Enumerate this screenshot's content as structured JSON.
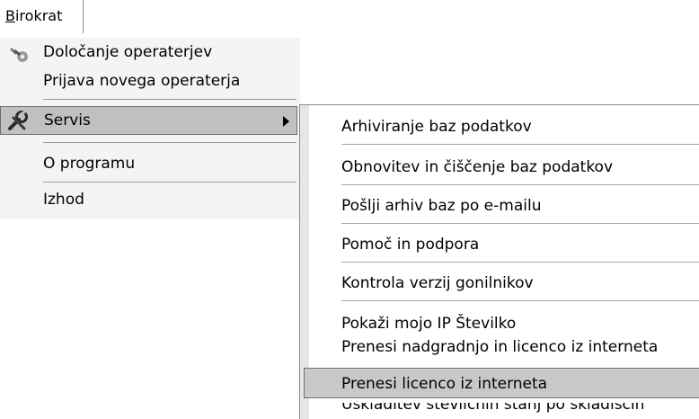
{
  "menubar": {
    "tab_label_accel": "B",
    "tab_label_rest": "irokrat"
  },
  "menu": {
    "items": [
      {
        "label": "Določanje operaterjev",
        "icon": "wrench-icon"
      },
      {
        "label": "Prijava novega operaterja"
      },
      {
        "label": "Servis",
        "icon": "tools-icon",
        "has_submenu": true
      },
      {
        "label": "O programu"
      },
      {
        "label": "Izhod"
      }
    ]
  },
  "submenu": {
    "items": [
      {
        "label": "Arhiviranje baz podatkov"
      },
      {
        "label": "Obnovitev in čiščenje baz podatkov"
      },
      {
        "label": "Pošlji arhiv baz po e-mailu"
      },
      {
        "label": "Pomoč in podpora"
      },
      {
        "label": "Kontrola verzij gonilnikov"
      },
      {
        "label": "Pokaži mojo IP Številko"
      },
      {
        "label": "Prenesi nadgradnjo in licenco iz interneta"
      },
      {
        "label": "Prenesi licenco iz interneta"
      },
      {
        "label": "Uskladitev številčnih stanj po skladiščih"
      }
    ]
  }
}
